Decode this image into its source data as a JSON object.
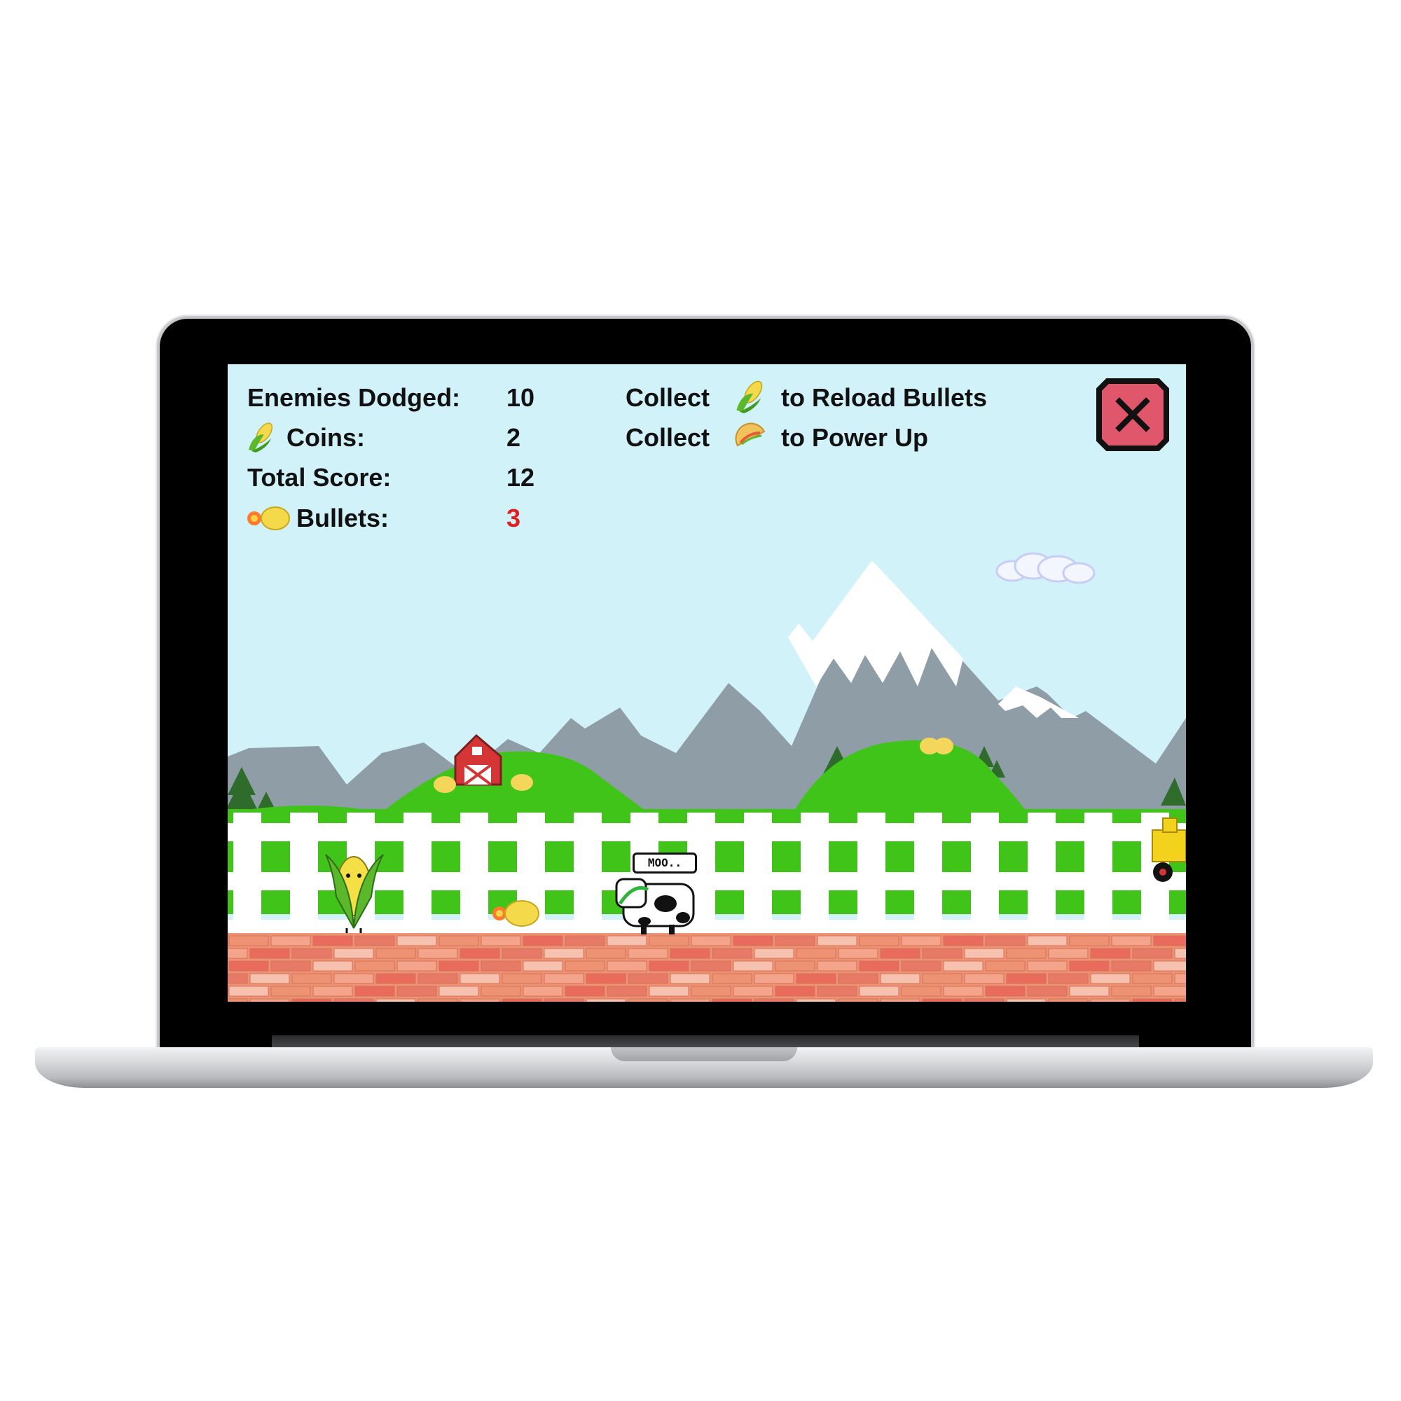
{
  "hud": {
    "enemies_dodged_label": "Enemies Dodged:",
    "enemies_dodged_value": "10",
    "coins_label": "Coins:",
    "coins_value": "2",
    "total_score_label": "Total Score:",
    "total_score_value": "12",
    "bullets_label": "Bullets:",
    "bullets_value": "3"
  },
  "instructions": {
    "line1_prefix": "Collect",
    "line1_suffix": "to Reload Bullets",
    "line2_prefix": "Collect",
    "line2_suffix": "to Power Up"
  },
  "player": {
    "speech": "MOO.."
  },
  "colors": {
    "sky": "#d1f2f9",
    "mountain": "#8f9ea6",
    "snow": "#ffffff",
    "hill": "#41c41a",
    "fence": "#ffffff",
    "brick": "#ee9274",
    "bullets_value": "#e02020",
    "close_button": "#e0566a"
  },
  "icons": [
    "corn-icon",
    "bullet-icon",
    "taco-icon",
    "close-icon"
  ]
}
